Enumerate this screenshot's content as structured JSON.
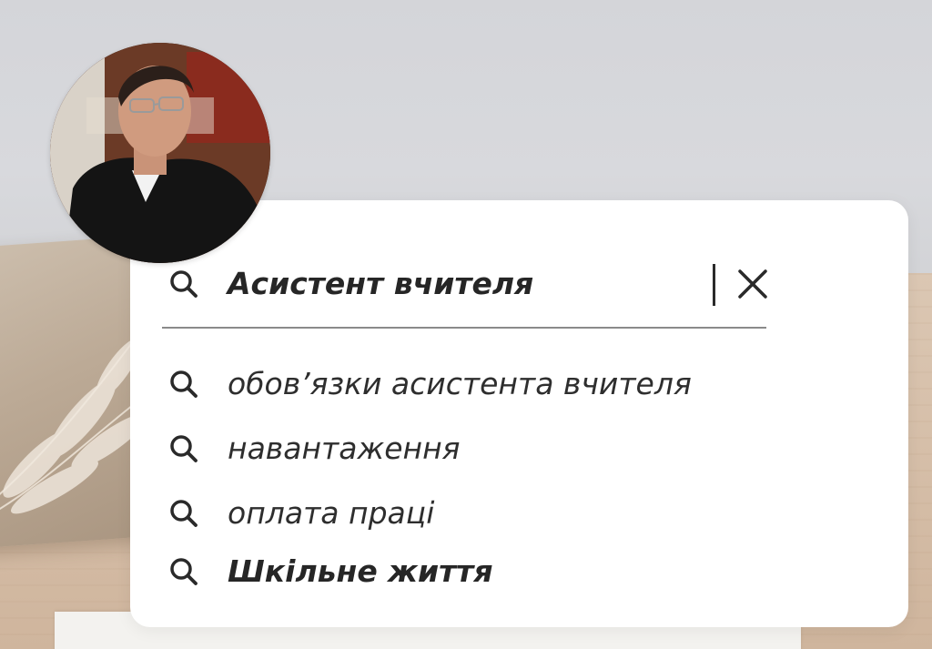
{
  "search": {
    "query": "Асистент вчителя",
    "suggestions": [
      {
        "label": "обов’язки асистента вчителя",
        "bold": false
      },
      {
        "label": "навантаження",
        "bold": false
      },
      {
        "label": "оплата праці",
        "bold": false
      },
      {
        "label": "Шкільне життя",
        "bold": true
      }
    ]
  },
  "icons": {
    "search": "search-icon",
    "clear": "close-icon"
  },
  "colors": {
    "card_background": "#ffffff",
    "text": "#262626",
    "underline": "#8a8a8a",
    "wall": "#d6d7db",
    "table": "#d6bfa9"
  }
}
